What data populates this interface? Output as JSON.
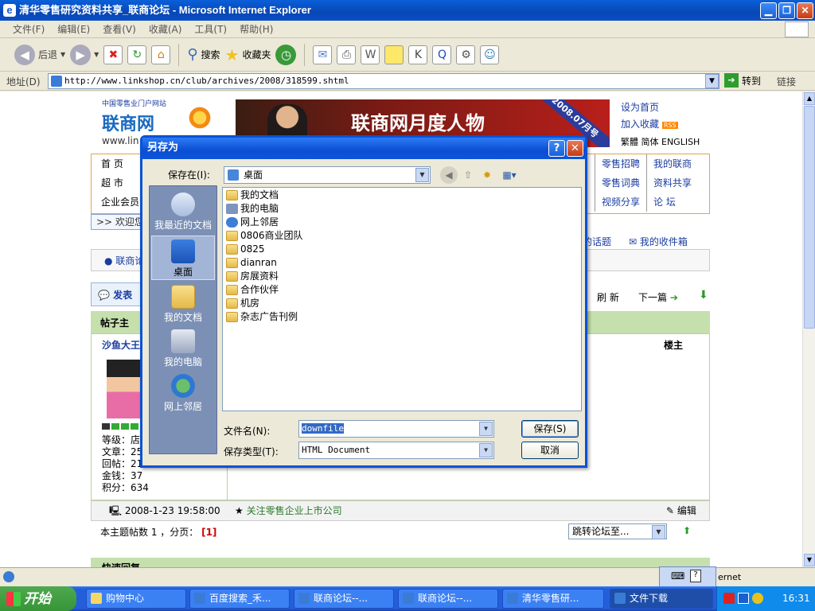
{
  "window": {
    "title": "清华零售研究资料共享_联商论坛 - Microsoft Internet Explorer",
    "logo_glyph": "e"
  },
  "menu": [
    "文件(F)",
    "编辑(E)",
    "查看(V)",
    "收藏(A)",
    "工具(T)",
    "帮助(H)"
  ],
  "toolbar": {
    "back": "后退",
    "search": "搜索",
    "favorites": "收藏夹"
  },
  "address": {
    "label": "地址(D)",
    "url": "http://www.linkshop.cn/club/archives/2008/318599.shtml",
    "go": "转到",
    "links": "链接"
  },
  "site": {
    "logo_top": "中国零售业门户网站",
    "logo_name": "联商网",
    "logo_url": "www.lin",
    "banner_title": "联商网月度人物",
    "banner_ribbon": "2008.07月号",
    "toplinks": [
      "设为首页",
      "加入收藏",
      "繁體 简体 ENGLISH"
    ],
    "nav_left": [
      "首   页",
      "超   市",
      "企业会员"
    ],
    "nav_right": [
      [
        "零售招聘",
        "我的联商"
      ],
      [
        "零售词典",
        "资料共享"
      ],
      [
        "视频分享",
        "论   坛"
      ]
    ],
    "welcome": ">> 欢迎您",
    "forum_tab": "联商论",
    "topic_link": "的话题",
    "inbox": "我的收件箱",
    "post_btn": "发表",
    "refresh": "刷 新",
    "next": "下一篇",
    "post_header": "帖子主",
    "floor": "楼主",
    "author": "沙鱼大王",
    "stats": [
      "等级：店",
      "文章：25",
      "回帖：21",
      "金钱：37",
      "积分：634"
    ],
    "post_date": "2008-1-23 19:58:00",
    "follow": "关注零售企业上市公司",
    "edit": "编辑",
    "pager": "本主题帖数 1 ，分页：",
    "page_num": "[1]",
    "jump": "跳转论坛至...",
    "quick_reply": "快速回复"
  },
  "dialog": {
    "title": "另存为",
    "save_in_label": "保存在(I):",
    "save_in_value": "桌面",
    "places": [
      "我最近的文档",
      "桌面",
      "我的文档",
      "我的电脑",
      "网上邻居"
    ],
    "selected_place": "桌面",
    "files": [
      "我的文档",
      "我的电脑",
      "网上邻居",
      "0806商业团队",
      "0825",
      "dianran",
      "房展资料",
      "合作伙伴",
      "机房",
      "杂志广告刊例"
    ],
    "filename_label": "文件名(N):",
    "filename_value": "downfile",
    "filetype_label": "保存类型(T):",
    "filetype_value": "HTML Document",
    "save_button": "保存(S)",
    "cancel_button": "取消"
  },
  "status": {
    "zone": "ernet"
  },
  "taskbar": {
    "start": "开始",
    "tasks": [
      "购物中心",
      "百度搜索_禾...",
      "联商论坛--...",
      "联商论坛--...",
      "清华零售研...",
      "文件下载"
    ],
    "active_task": "文件下载",
    "clock": "16:31"
  }
}
